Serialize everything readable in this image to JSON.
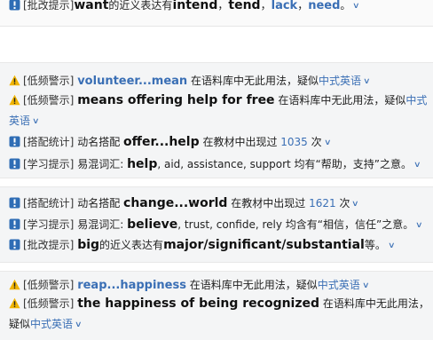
{
  "rows": [
    {
      "tag": "[批改提示]",
      "t1": "want",
      "t2": "的近义表达有",
      "t3": "intend",
      "t4": "，",
      "t5": "tend",
      "t6": "，",
      "t7": "lack",
      "t8": "，",
      "t9": "need",
      "t10": "。"
    },
    {
      "tag": "[低频警示]",
      "kw": "volunteer...mean",
      "t1": " 在语料库中无此用法，疑似",
      "link": "中式英语"
    },
    {
      "tag": "[低频警示]",
      "big": "means offering help for free",
      "t1": " 在语料库中无此用法，疑似",
      "link": "中式英语"
    },
    {
      "tag": "[搭配统计]",
      "t1": " 动名搭配 ",
      "big": "offer...help",
      "t2": " 在教材中出现过 ",
      "num": "1035",
      "t3": " 次"
    },
    {
      "tag": "[学习提示]",
      "t1": " 易混词汇: ",
      "big": "help",
      "t2": ", aid, assistance, support 均有“帮助，支持”之意。"
    },
    {
      "tag": "[搭配统计]",
      "t1": " 动名搭配 ",
      "big": "change...world",
      "t2": " 在教材中出现过 ",
      "num": "1621",
      "t3": " 次"
    },
    {
      "tag": "[学习提示]",
      "t1": " 易混词汇: ",
      "big": "believe",
      "t2": ", trust, confide, rely 均含有“相信，信任”之意。"
    },
    {
      "tag": "[批改提示]",
      "big": "big",
      "t1": "的近义表达有",
      "big2": "major/significant/substantial",
      "t2": "等。"
    },
    {
      "tag": "[低频警示]",
      "kw": "reap...happiness",
      "t1": " 在语料库中无此用法，疑似",
      "link": "中式英语"
    },
    {
      "tag": "[低频警示]",
      "big": "the happiness of being recognized",
      "t1": " 在语料库中无此用法，疑似",
      "link": "中式英语"
    }
  ],
  "icons": {
    "warning_color": "#f0b400",
    "info_color": "#2f6db5"
  }
}
